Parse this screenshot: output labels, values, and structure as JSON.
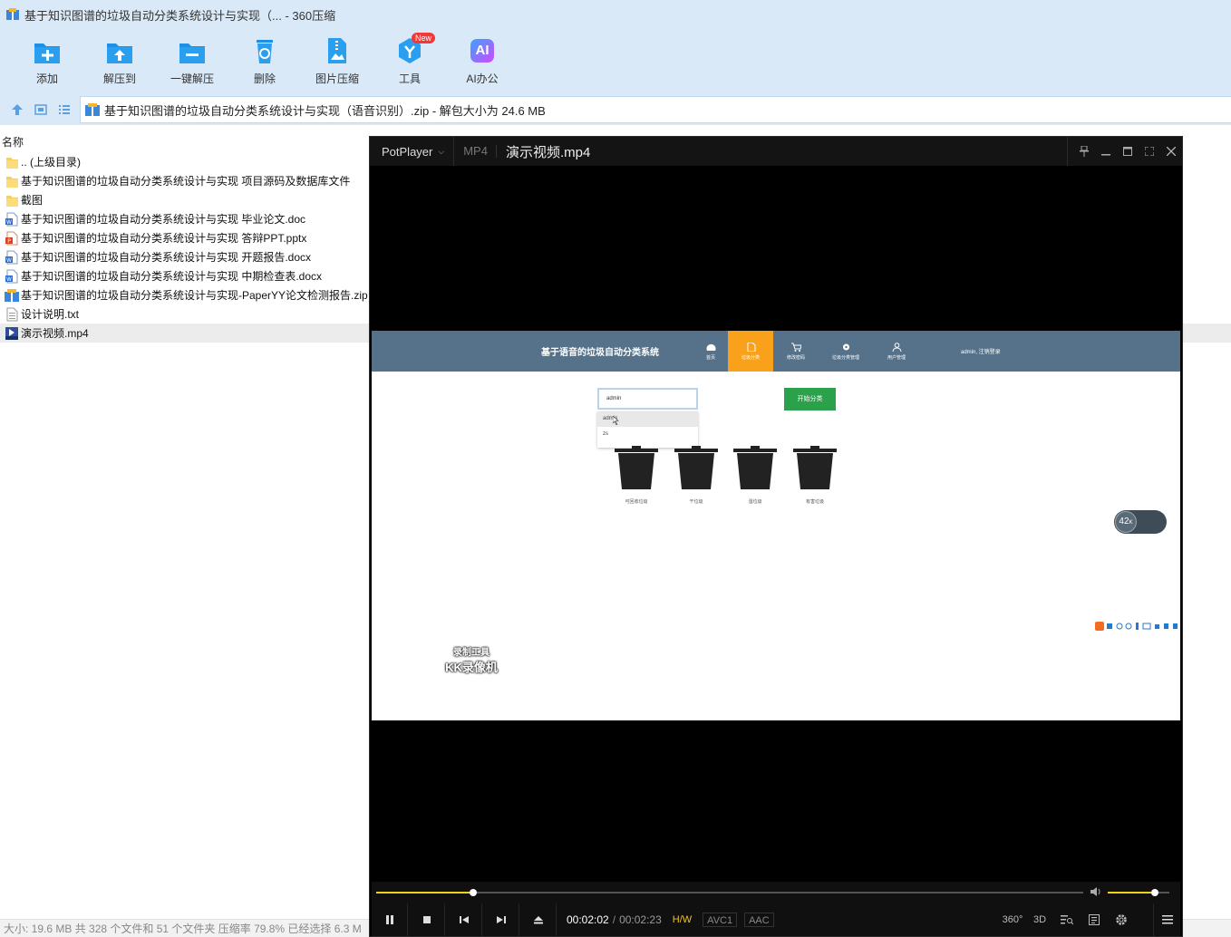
{
  "zip": {
    "title": "基于知识图谱的垃圾自动分类系统设计与实现（... - 360压缩",
    "toolbar": [
      {
        "label": "添加",
        "icon": "add-icon"
      },
      {
        "label": "解压到",
        "icon": "extract-to-icon"
      },
      {
        "label": "一键解压",
        "icon": "one-click-extract-icon"
      },
      {
        "label": "删除",
        "icon": "delete-icon"
      },
      {
        "label": "图片压缩",
        "icon": "image-compress-icon"
      },
      {
        "label": "工具",
        "icon": "tools-icon",
        "badge": "New"
      },
      {
        "label": "AI办公",
        "icon": "ai-office-icon",
        "icon_text": "AI"
      }
    ],
    "address": "基于知识图谱的垃圾自动分类系统设计与实现（语音识别）.zip - 解包大小为 24.6 MB",
    "column_name": "名称",
    "files": [
      {
        "name": ".. (上级目录)",
        "type": "folder"
      },
      {
        "name": "基于知识图谱的垃圾自动分类系统设计与实现 项目源码及数据库文件",
        "type": "folder"
      },
      {
        "name": "截图",
        "type": "folder"
      },
      {
        "name": "基于知识图谱的垃圾自动分类系统设计与实现 毕业论文.doc",
        "type": "doc"
      },
      {
        "name": "基于知识图谱的垃圾自动分类系统设计与实现 答辩PPT.pptx",
        "type": "ppt"
      },
      {
        "name": "基于知识图谱的垃圾自动分类系统设计与实现 开题报告.docx",
        "type": "doc"
      },
      {
        "name": "基于知识图谱的垃圾自动分类系统设计与实现 中期检查表.docx",
        "type": "doc"
      },
      {
        "name": "基于知识图谱的垃圾自动分类系统设计与实现-PaperYY论文检测报告.zip",
        "type": "zip"
      },
      {
        "name": "设计说明.txt",
        "type": "txt"
      },
      {
        "name": "演示视频.mp4",
        "type": "mp4",
        "selected": true
      }
    ],
    "status": "大小: 19.6 MB 共 328 个文件和 51 个文件夹 压缩率 79.8% 已经选择 6.3 M"
  },
  "player": {
    "brand": "PotPlayer",
    "format": "MP4",
    "filename": "演示视频.mp4",
    "current_time": "00:02:02",
    "separator": "/",
    "total_time": "00:02:23",
    "progress": 0.137,
    "volume": 0.77,
    "tags": [
      "H/W",
      "AVC1",
      "AAC"
    ],
    "right_controls": [
      "360°",
      "3D"
    ]
  },
  "video": {
    "brand": "基于语音的垃圾自动分类系统",
    "nav": [
      {
        "label": "首页",
        "icon": "dashboard-icon"
      },
      {
        "label": "垃圾分类",
        "icon": "document-icon",
        "active": true
      },
      {
        "label": "修改密码",
        "icon": "cart-icon"
      },
      {
        "label": "垃圾分类管理",
        "icon": "gear-icon"
      },
      {
        "label": "用户管理",
        "icon": "user-icon"
      }
    ],
    "user": "admin, 注销登录",
    "input_value": "admin",
    "dropdown": [
      "admin",
      "zs"
    ],
    "start_button": "开始分类",
    "bins": [
      "可回收垃圾",
      "干垃圾",
      "湿垃圾",
      "有害垃圾"
    ],
    "speed": "42",
    "watermark_line1": "录制工具",
    "watermark_line2": "KK录像机"
  }
}
